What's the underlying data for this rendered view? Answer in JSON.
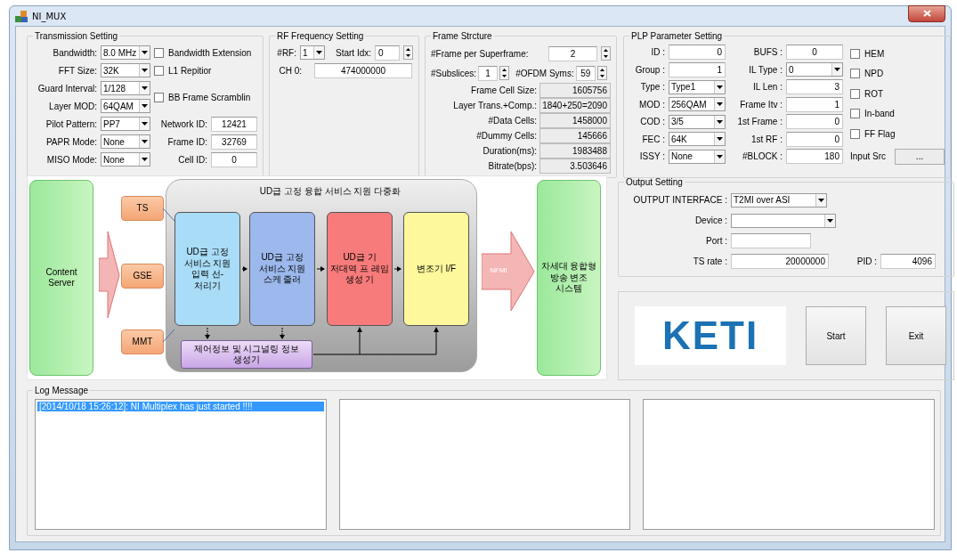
{
  "window": {
    "title": "NI_MUX"
  },
  "transmission": {
    "title": "Transmission Setting",
    "dropdowns": [
      {
        "label": "Bandwidth:",
        "value": "8.0 MHz"
      },
      {
        "label": "FFT Size:",
        "value": "32K"
      },
      {
        "label": "Guard Interval:",
        "value": "1/128"
      },
      {
        "label": "Layer MOD:",
        "value": "64QAM"
      },
      {
        "label": "Pilot Pattern:",
        "value": "PP7"
      },
      {
        "label": "PAPR Mode:",
        "value": "None"
      },
      {
        "label": "MISO Mode:",
        "value": "None"
      }
    ],
    "checkboxes": [
      {
        "label": "Bandwidth Extension",
        "checked": false
      },
      {
        "label": "L1 Repitior",
        "checked": false
      },
      {
        "label": "BB Frame Scramblin",
        "checked": false
      }
    ],
    "fields": [
      {
        "label": "Network ID:",
        "value": "12421"
      },
      {
        "label": "Frame ID:",
        "value": "32769"
      },
      {
        "label": "Cell ID:",
        "value": "0"
      }
    ]
  },
  "rf": {
    "title": "RF Frequency Setting",
    "rf_count": {
      "label": "#RF:",
      "value": "1"
    },
    "start_idx": {
      "label": "Start Idx:",
      "value": "0"
    },
    "channel": {
      "label": "CH 0:",
      "value": "474000000"
    }
  },
  "frame": {
    "title": "Frame Strcture",
    "superframe": {
      "label": "#Frame per Superframe:",
      "value": "2"
    },
    "subslices": {
      "label": "#Subslices:",
      "value": "1"
    },
    "ofdm": {
      "label": "#OFDM Syms:",
      "value": "59"
    },
    "readouts": [
      {
        "label": "Frame Cell Size:",
        "value": "1605756"
      },
      {
        "label": "Layer Trans.+Comp.:",
        "value": "1840+250=2090"
      },
      {
        "label": "#Data Cells:",
        "value": "1458000"
      },
      {
        "label": "#Dummy Cells:",
        "value": "145666"
      },
      {
        "label": "Duration(ms):",
        "value": "1983488"
      },
      {
        "label": "Bitrate(bps):",
        "value": "3.503646"
      }
    ]
  },
  "plp": {
    "title": "PLP Parameter Setting",
    "left": [
      {
        "kind": "field",
        "label": "ID :",
        "value": "0"
      },
      {
        "kind": "field",
        "label": "Group :",
        "value": "1"
      },
      {
        "kind": "dropdown",
        "label": "Type :",
        "value": "Type1"
      },
      {
        "kind": "dropdown",
        "label": "MOD :",
        "value": "256QAM"
      },
      {
        "kind": "dropdown",
        "label": "COD :",
        "value": "3/5"
      },
      {
        "kind": "dropdown",
        "label": "FEC :",
        "value": "64K"
      },
      {
        "kind": "dropdown",
        "label": "ISSY :",
        "value": "None"
      }
    ],
    "middle": [
      {
        "kind": "centered_field",
        "label": "BUFS :",
        "value": "0"
      },
      {
        "kind": "dropdown",
        "label": "IL Type :",
        "value": "0"
      },
      {
        "kind": "field",
        "label": "IL Len :",
        "value": "3"
      },
      {
        "kind": "field",
        "label": "Frame Itv :",
        "value": "1"
      },
      {
        "kind": "field",
        "label": "1st Frame :",
        "value": "0"
      },
      {
        "kind": "field",
        "label": "1st RF :",
        "value": "0"
      },
      {
        "kind": "field",
        "label": "#BLOCK :",
        "value": "180"
      }
    ],
    "checkboxes": [
      {
        "label": "HEM",
        "checked": false
      },
      {
        "label": "NPD",
        "checked": false
      },
      {
        "label": "ROT",
        "checked": false
      },
      {
        "label": "In-band",
        "checked": false
      },
      {
        "label": "FF Flag",
        "checked": false
      }
    ],
    "input_src": {
      "label": "Input Src",
      "button": "..."
    }
  },
  "diagram": {
    "source": "Content Server",
    "inputs": [
      "TS",
      "GSE",
      "MMT"
    ],
    "group_title": "UD급 고정 융합 서비스 지원 다중화",
    "blocks": [
      {
        "text": "UD급 고정 서비스 지원 입력 선-처리기",
        "color": "#a9dcf7"
      },
      {
        "text": "UD급 고정 서비스 지원 스케 줄러",
        "color": "#9cb8ec"
      },
      {
        "text": "UD급 기 저대역 프 레임 생성 기",
        "color": "#f77b7b"
      },
      {
        "text": "변조기 I/F",
        "color": "#fdf89c"
      }
    ],
    "control_block": "제어정보 및 시그널링 정보 생성기",
    "link_label": "NFMI",
    "target": "차세대 융합형 방송 변조 시스템"
  },
  "output": {
    "title": "Output Setting",
    "interface": {
      "label": "OUTPUT INTERFACE :",
      "value": "T2MI over ASI"
    },
    "device": {
      "label": "Device :"
    },
    "port": {
      "label": "Port :"
    },
    "ts_rate": {
      "label": "TS rate :",
      "value": "20000000"
    },
    "pid": {
      "label": "PID :",
      "value": "4096"
    }
  },
  "logo": "KETI",
  "buttons": [
    "Start",
    "Exit"
  ],
  "log": {
    "title": "Log Message",
    "entries": [
      {
        "text": "[2014/10/18 15:26:12]: NI Multiplex has just started !!!!",
        "selected": true
      }
    ]
  }
}
